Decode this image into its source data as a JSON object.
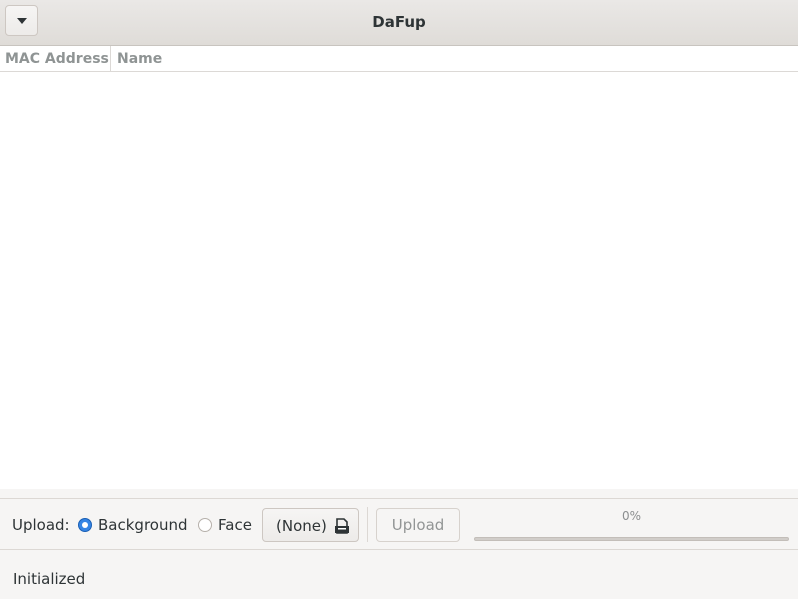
{
  "window": {
    "title": "DaFup",
    "menu_icon": "pan-down-icon"
  },
  "table": {
    "columns": [
      "MAC Address",
      "Name"
    ],
    "rows": []
  },
  "upload": {
    "label": "Upload:",
    "options": [
      {
        "label": "Background",
        "selected": true
      },
      {
        "label": "Face",
        "selected": false
      }
    ],
    "file_chooser_label": "(None)",
    "file_chooser_icon": "document-open-icon",
    "upload_button_label": "Upload",
    "upload_button_enabled": false,
    "progress_text": "0%",
    "progress_fraction": 0
  },
  "status": {
    "text": "Initialized"
  },
  "colors": {
    "accent": "#3584e4",
    "titlebar": "#dfdcd8",
    "background": "#f6f5f4"
  }
}
